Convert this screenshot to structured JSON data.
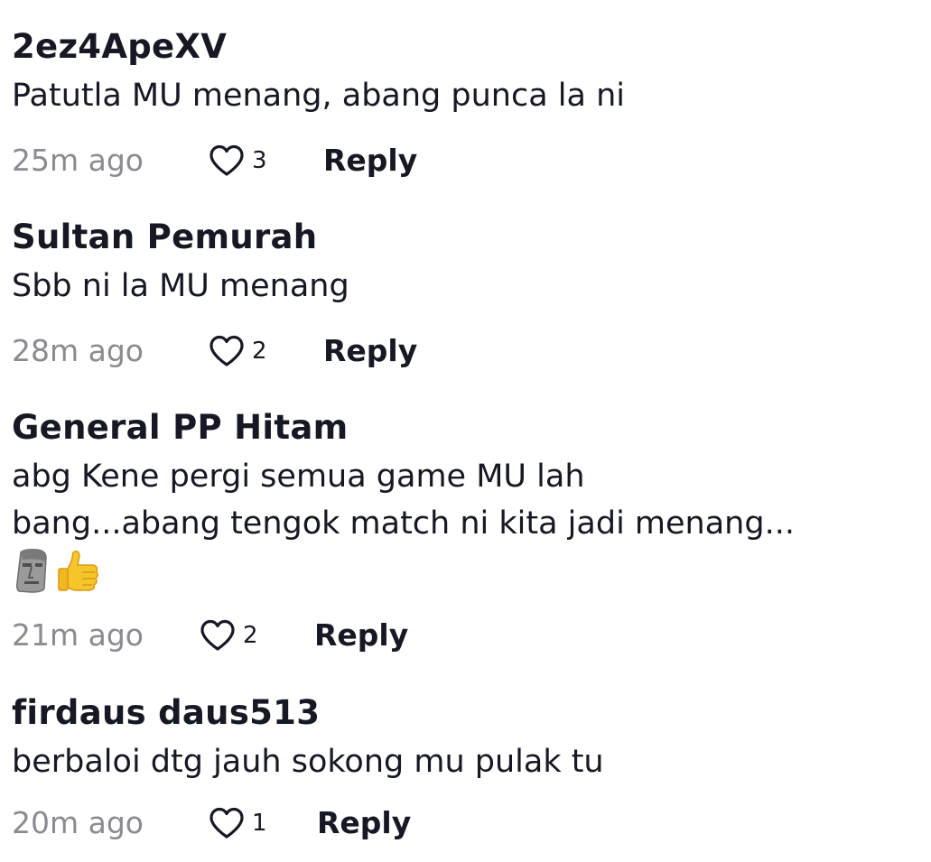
{
  "comments": [
    {
      "username": "2ez4ApeXV",
      "text": "Patutla MU menang, abang punca la ni",
      "time": "25m ago",
      "likes": "3",
      "reply_label": "Reply"
    },
    {
      "username": "Sultan Pemurah",
      "text": "Sbb ni la MU menang",
      "time": "28m ago",
      "likes": "2",
      "reply_label": "Reply"
    },
    {
      "username": "General PP Hitam",
      "text_line1": "abg Kene pergi semua game MU lah",
      "text_line2": "bang...abang tengok match ni kita jadi menang...",
      "emojis": [
        "moai-emoji",
        "thumbs-up-emoji"
      ],
      "time": "21m ago",
      "likes": "2",
      "reply_label": "Reply"
    },
    {
      "username": "firdaus daus513",
      "text": "berbaloi dtg jauh sokong mu pulak tu",
      "time": "20m ago",
      "likes": "1",
      "reply_label": "Reply"
    }
  ],
  "colors": {
    "text_primary": "#161823",
    "text_secondary": "#8a8b91",
    "emoji_yellow": "#f5c52b",
    "emoji_stone": "#8e8e8e"
  }
}
